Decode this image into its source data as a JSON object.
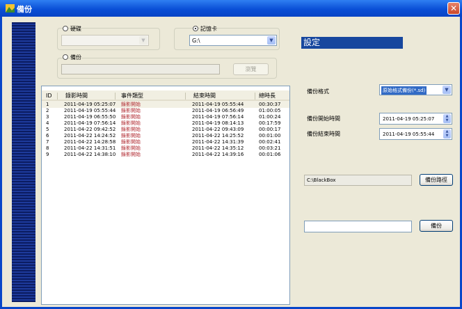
{
  "window": {
    "title": "備份",
    "close_glyph": "✕",
    "accent": "#0a4fd6"
  },
  "source": {
    "disk_label": "硬碟",
    "disk_drive": "",
    "card_label": "記憶卡",
    "card_drive": "G:\\",
    "selected": "card"
  },
  "backup_file": {
    "label": "備份",
    "path": "",
    "browse_label": "瀏覽"
  },
  "settings": {
    "title": "設定",
    "format_label": "備份格式",
    "format_value": "原始格式備份(*.sd)",
    "start_label": "備份開始時間",
    "start_value": "2011-04-19 05:25:07",
    "end_label": "備份結束時間",
    "end_value": "2011-04-19 05:55:44",
    "path_value": "C:\\BlackBox",
    "path_button": "備份路徑",
    "status_value": "",
    "backup_button": "備份"
  },
  "table": {
    "columns": [
      "ID",
      "錄影時間",
      "事件類型",
      "結束時間",
      "總時長"
    ],
    "rows": [
      [
        "1",
        "2011-04-19 05:25:07",
        "錄影開始",
        "2011-04-19 05:55:44",
        "00:30:37"
      ],
      [
        "2",
        "2011-04-19 05:55:44",
        "錄影開始",
        "2011-04-19 06:56:49",
        "01:00:05"
      ],
      [
        "3",
        "2011-04-19 06:55:50",
        "錄影開始",
        "2011-04-19 07:56:14",
        "01:00:24"
      ],
      [
        "4",
        "2011-04-19 07:56:14",
        "錄影開始",
        "2011-04-19 08:14:13",
        "00:17:59"
      ],
      [
        "5",
        "2011-04-22 09:42:52",
        "錄影開始",
        "2011-04-22 09:43:09",
        "00:00:17"
      ],
      [
        "6",
        "2011-04-22 14:24:52",
        "錄影開始",
        "2011-04-22 14:25:52",
        "00:01:00"
      ],
      [
        "7",
        "2011-04-22 14:28:58",
        "錄影開始",
        "2011-04-22 14:31:39",
        "00:02:41"
      ],
      [
        "8",
        "2011-04-22 14:31:51",
        "錄影開始",
        "2011-04-22 14:35:12",
        "00:03:21"
      ],
      [
        "9",
        "2011-04-22 14:38:10",
        "錄影開始",
        "2011-04-22 14:39:16",
        "00:01:06"
      ]
    ]
  }
}
